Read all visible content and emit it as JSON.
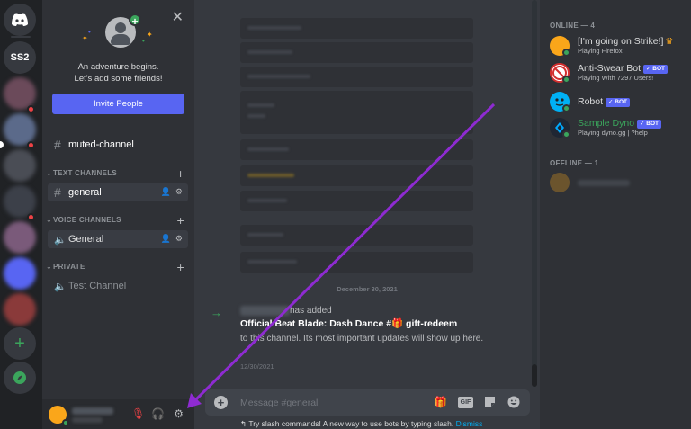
{
  "rail": {
    "server_badge": "SS2"
  },
  "sidebar": {
    "welcome_title": "An adventure begins.",
    "welcome_sub": "Let's add some friends!",
    "invite_label": "Invite People",
    "muted_channel": "muted-channel",
    "categories": {
      "text": "TEXT CHANNELS",
      "voice": "VOICE CHANNELS",
      "private": "PRIVATE"
    },
    "channels": {
      "general_text": "general",
      "general_voice": "General",
      "test_channel": "Test Channel"
    }
  },
  "chat": {
    "date_divider": "December 30, 2021",
    "system_action": "has added",
    "system_title": "Official Beat Blade: Dash Dance #🎁 gift-redeem",
    "system_body": "to this channel. Its most important updates will show up here.",
    "system_time": "12/30/2021",
    "composer_placeholder": "Message #general",
    "gif_label": "GIF",
    "hint_text": "Try slash commands! A new way to use bots by typing slash.",
    "hint_dismiss": "Dismiss"
  },
  "members": {
    "online_header": "ONLINE — 4",
    "offline_header": "OFFLINE — 1",
    "bot_tag": "✓ BOT",
    "list": [
      {
        "name": "[I'm going on Strike!]",
        "activity": "Playing Firefox",
        "color": "#dcddde"
      },
      {
        "name": "Anti-Swear Bot",
        "activity": "Playing With 7297 Users!",
        "color": "#dcddde"
      },
      {
        "name": "Robot",
        "activity": "",
        "color": "#dcddde"
      },
      {
        "name": "Sample Dyno",
        "activity": "Playing dyno.gg | ?help",
        "color": "#3ba55c"
      }
    ]
  },
  "colors": {
    "blurple": "#5865f2",
    "green": "#3ba55c",
    "arrow": "#8e2bd1"
  }
}
